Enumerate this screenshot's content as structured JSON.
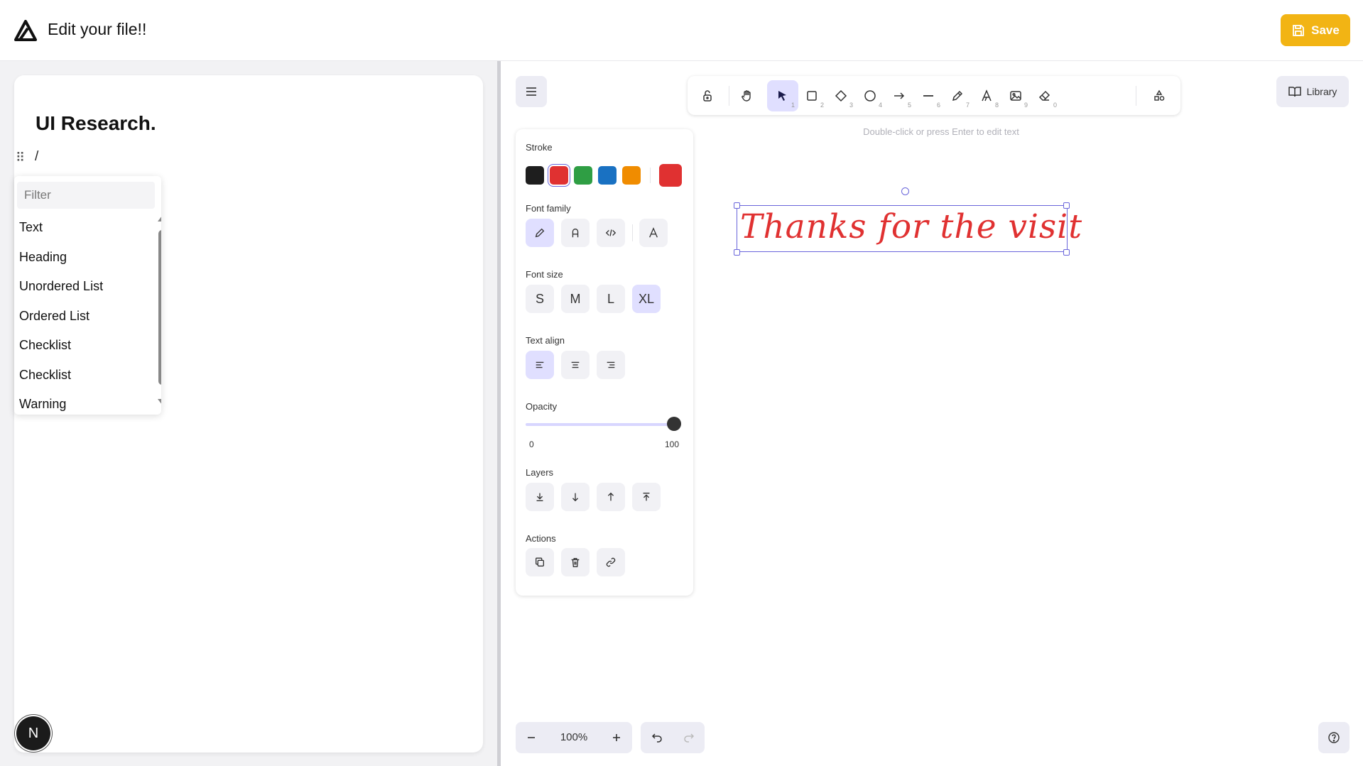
{
  "header": {
    "title": "Edit your file!!",
    "save_label": "Save",
    "accent": "#f2b414"
  },
  "editor": {
    "doc_title": "UI Research.",
    "slash": "/",
    "slash_menu": {
      "filter_placeholder": "Filter",
      "items": [
        "Text",
        "Heading",
        "Unordered List",
        "Ordered List",
        "Checklist",
        "Checklist",
        "Warning"
      ]
    },
    "badge": "N"
  },
  "canvas": {
    "toolbar": {
      "tools": [
        {
          "name": "lock",
          "num": ""
        },
        {
          "name": "hand",
          "num": ""
        },
        {
          "name": "selection",
          "num": "1"
        },
        {
          "name": "rectangle",
          "num": "2"
        },
        {
          "name": "diamond",
          "num": "3"
        },
        {
          "name": "ellipse",
          "num": "4"
        },
        {
          "name": "arrow",
          "num": "5"
        },
        {
          "name": "line",
          "num": "6"
        },
        {
          "name": "draw",
          "num": "7"
        },
        {
          "name": "text",
          "num": "8"
        },
        {
          "name": "image",
          "num": "9"
        },
        {
          "name": "eraser",
          "num": "0"
        },
        {
          "name": "extra-tools",
          "num": ""
        }
      ]
    },
    "library_label": "Library",
    "hint": "Double-click or press Enter to edit text",
    "props": {
      "stroke_label": "Stroke",
      "stroke_colors": [
        "#1e1e1e",
        "#e03131",
        "#2f9e44",
        "#1971c2",
        "#f08c00"
      ],
      "stroke_selected": "#e03131",
      "font_family_label": "Font family",
      "font_size_label": "Font size",
      "font_sizes": [
        "S",
        "M",
        "L",
        "XL"
      ],
      "text_align_label": "Text align",
      "opacity_label": "Opacity",
      "opacity_value": 100,
      "opacity_min": "0",
      "opacity_max": "100",
      "layers_label": "Layers",
      "actions_label": "Actions"
    },
    "text_element": "Thanks for the visit",
    "zoom": "100%"
  }
}
